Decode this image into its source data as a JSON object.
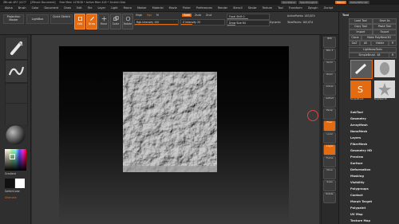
{
  "titlebar": {
    "app": "ZBrush 4R7 (4177",
    "doc": "[ZBrush Document]",
    "stats": "Free Mem 1478GB • Active Mem 416 • Scratch Disk",
    "quicksave": "QuickSave",
    "seethrough": "See-through 0",
    "menus": "Menus",
    "script": "DefaultZScript"
  },
  "menubar": [
    "Alpha",
    "Brush",
    "Color",
    "Document",
    "Draw",
    "Edit",
    "File",
    "Layer",
    "Light",
    "Macro",
    "Marker",
    "Material",
    "Movie",
    "Picker",
    "Preferences",
    "Render",
    "Stencil",
    "Stroke",
    "Texture",
    "Tool",
    "Transform",
    "Zplugin",
    "Zscript"
  ],
  "topshelf": {
    "projection_master": "Projection Master",
    "lightbox": "LightBox",
    "quick_sketch": "Quick Sketch",
    "edit": "Edit",
    "draw": "Draw",
    "move": "Move",
    "scale": "Scale",
    "rotate": "Rotate",
    "mrgb": "Mrgb",
    "rgb": "Rgb",
    "m": "M",
    "rgb_intensity": "Rgb Intensity 100",
    "zadd": "Zadd",
    "zsub": "Zsub",
    "zcut": "Zcut",
    "z_intensity": "Z Intensity 25",
    "focal_shift": "Focal Shift 0",
    "draw_size": "Draw Size 64",
    "dynamic": "Dynamic",
    "active_points": "ActivePoints: 183,874",
    "total_points": "TotalPoints: 183,874"
  },
  "leftshelf": {
    "gradient": "Gradient",
    "switch_color": "SwitchColor",
    "alternate": "Alternate"
  },
  "rightstrip": [
    "BPR",
    "SPix 3",
    "Scroll",
    "Zoom",
    "Actual",
    "AAHalf",
    "Persp",
    "Floor",
    "Local",
    "L.Sym",
    "Frame",
    "Move",
    "Scale",
    "Rotate"
  ],
  "toolpanel": {
    "title": "Tool",
    "load_tool": "Load Tool",
    "save_as": "Save As",
    "copy_tool": "Copy Tool",
    "paste_tool": "Paste Tool",
    "import": "Import",
    "export": "Export",
    "clone": "Clone",
    "make_polymesh": "Make PolyMesh3D",
    "goz": "GoZ",
    "all": "All",
    "visible": "Visible",
    "r": "R",
    "lightbox_tools": "Lightbox▸Tools",
    "tool_name": "SimpleBrush. 48",
    "r2": "R",
    "thumb_labels": [
      "Cylinder3D",
      "PolyMesh3D",
      "SimpleBrush",
      "Cylinder3D"
    ],
    "subpanels": [
      "SubTool",
      "Geometry",
      "ArrayMesh",
      "NanoMesh",
      "Layers",
      "FiberMesh",
      "Geometry HD",
      "Preview",
      "Surface",
      "Deformation",
      "Masking",
      "Visibility",
      "Polygroups",
      "Contact",
      "Morph Target",
      "Polypaint",
      "UV Map",
      "Texture Map"
    ]
  },
  "colors": {
    "accent": "#e36b12",
    "panel": "#2f2f2f",
    "bg": "#2b2b2b"
  }
}
